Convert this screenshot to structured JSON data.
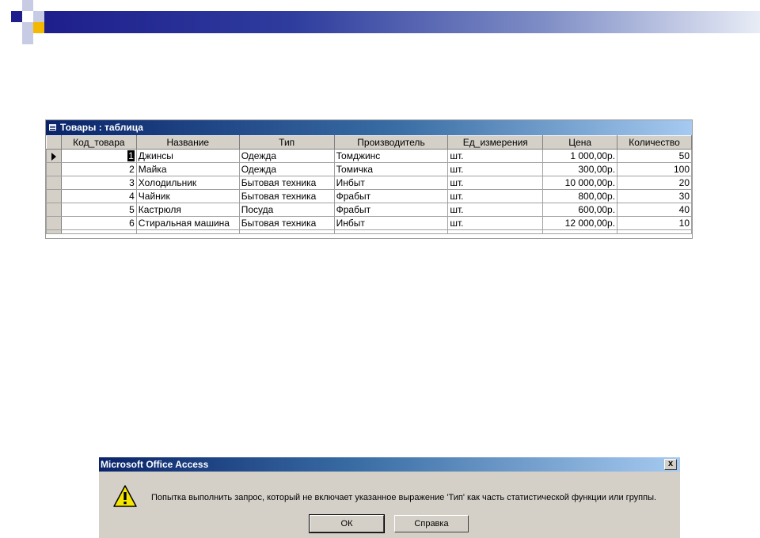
{
  "table_window": {
    "title": "Товары : таблица",
    "columns": [
      "Код_товара",
      "Название",
      "Тип",
      "Производитель",
      "Ед_измерения",
      "Цена",
      "Количество"
    ],
    "rows": [
      {
        "id": "1",
        "name": "Джинсы",
        "type": "Одежда",
        "maker": "Томджинс",
        "unit": "шт.",
        "price": "1 000,00р.",
        "qty": "50"
      },
      {
        "id": "2",
        "name": "Майка",
        "type": "Одежда",
        "maker": "Томичка",
        "unit": "шт.",
        "price": "300,00р.",
        "qty": "100"
      },
      {
        "id": "3",
        "name": "Холодильник",
        "type": "Бытовая техника",
        "maker": "Инбыт",
        "unit": "шт.",
        "price": "10 000,00р.",
        "qty": "20"
      },
      {
        "id": "4",
        "name": "Чайник",
        "type": "Бытовая техника",
        "maker": "Фрабыт",
        "unit": "шт.",
        "price": "800,00р.",
        "qty": "30"
      },
      {
        "id": "5",
        "name": "Кастрюля",
        "type": "Посуда",
        "maker": "Фрабыт",
        "unit": "шт.",
        "price": "600,00р.",
        "qty": "40"
      },
      {
        "id": "6",
        "name": "Стиральная машина",
        "type": "Бытовая техника",
        "maker": "Инбыт",
        "unit": "шт.",
        "price": "12 000,00р.",
        "qty": "10"
      }
    ]
  },
  "dialog": {
    "title": "Microsoft Office Access",
    "close_label": "x",
    "message": "Попытка выполнить запрос, который не включает указанное выражение 'Тип' как часть статистической функции или группы.",
    "ok_label": "ОК",
    "help_label": "Справка",
    "icon": "warning-icon"
  },
  "colors": {
    "header_dark": "#1e1e8c",
    "header_accent": "#f5b800",
    "titlebar": "#0a246a"
  }
}
